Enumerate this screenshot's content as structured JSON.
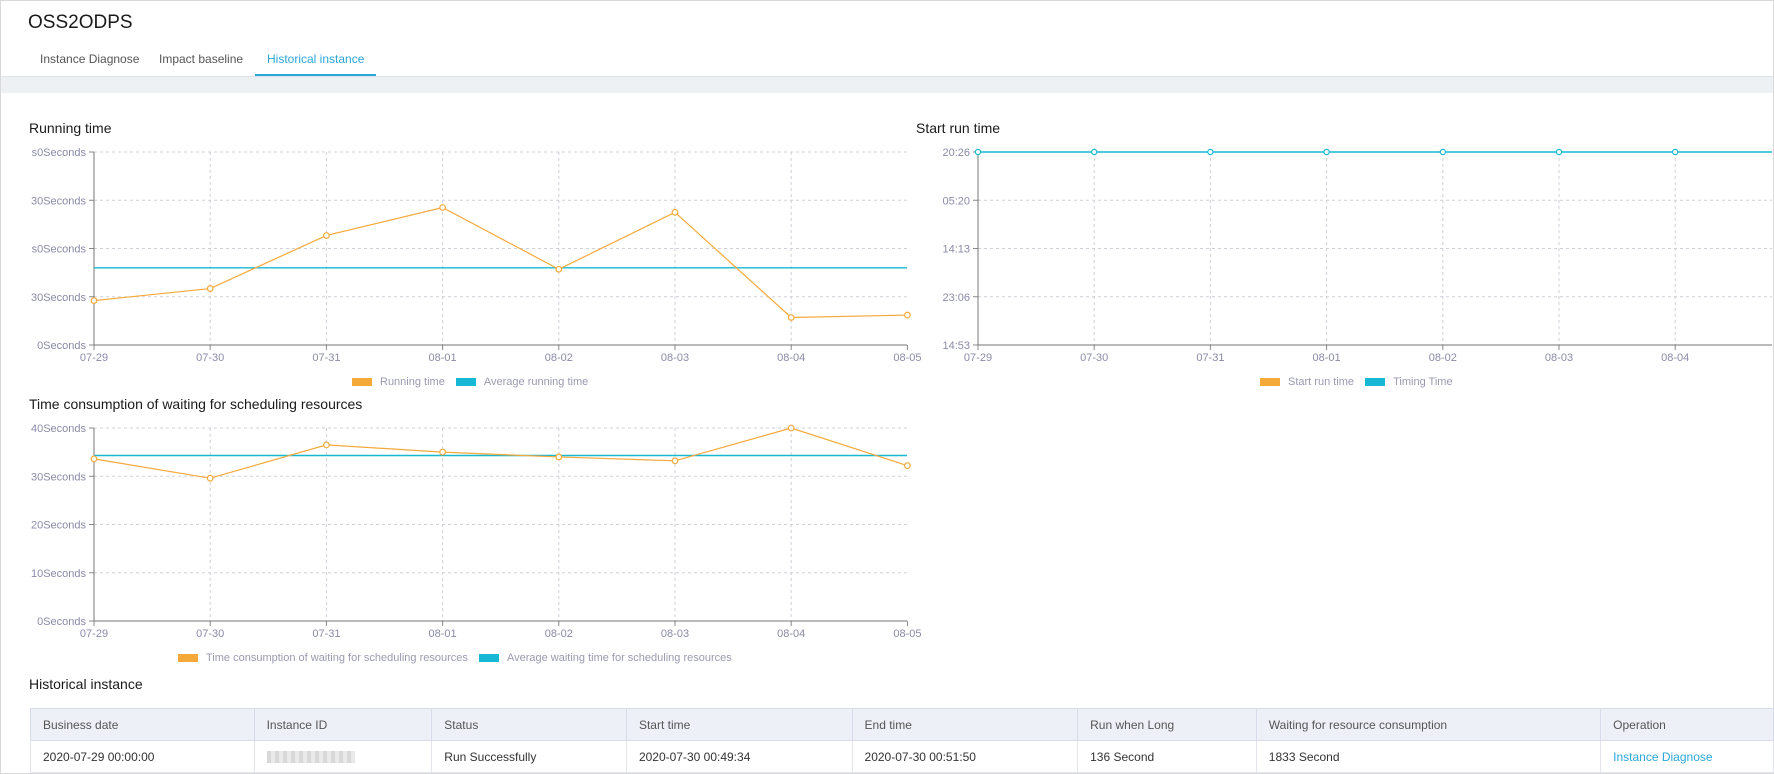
{
  "page": {
    "title": "OSS2ODPS",
    "tabs": [
      "Instance Diagnose",
      "Impact baseline",
      "Historical instance"
    ],
    "active_tab": "Historical instance"
  },
  "colors": {
    "primary_series": "#f5a93b",
    "average_series": "#17b8d4",
    "active_tab": "#2aa7d8",
    "success": "#3aa83a"
  },
  "chart_data": [
    {
      "id": "running_time",
      "type": "line",
      "title": "Running time",
      "categories": [
        "07-29",
        "07-30",
        "07-31",
        "08-01",
        "08-02",
        "08-03",
        "08-04",
        "08-05"
      ],
      "y_tick_labels": [
        "0Seconds",
        "30Seconds",
        "s0Seconds",
        "30Seconds",
        "s0Seconds"
      ],
      "ylim": [
        0,
        4
      ],
      "grid": true,
      "legend_position": "bottom",
      "series": [
        {
          "name": "Running time",
          "color": "#f5a93b",
          "values": [
            0.92,
            1.17,
            2.27,
            2.85,
            1.57,
            2.75,
            0.57,
            0.62
          ]
        },
        {
          "name": "Average running time",
          "color": "#17b8d4",
          "values": [
            1.6,
            1.6,
            1.6,
            1.6,
            1.6,
            1.6,
            1.6,
            1.6
          ]
        }
      ]
    },
    {
      "id": "start_run_time",
      "type": "line",
      "title": "Start run time",
      "categories": [
        "07-29",
        "07-30",
        "07-31",
        "08-01",
        "08-02",
        "08-03",
        "08-04"
      ],
      "y_tick_labels": [
        "14:53",
        "23:06",
        "14:13",
        "05:20",
        "20:26"
      ],
      "ylim": [
        0,
        4
      ],
      "grid": true,
      "legend_position": "bottom",
      "series": [
        {
          "name": "Start run time",
          "color": "#f5a93b",
          "values": [
            4,
            4,
            4,
            4,
            4,
            4,
            4
          ]
        },
        {
          "name": "Timing Time",
          "color": "#17b8d4",
          "values": [
            4,
            4,
            4,
            4,
            4,
            4,
            4
          ]
        }
      ]
    },
    {
      "id": "waiting_time",
      "type": "line",
      "title": "Time consumption of waiting for scheduling resources",
      "categories": [
        "07-29",
        "07-30",
        "07-31",
        "08-01",
        "08-02",
        "08-03",
        "08-04",
        "08-05"
      ],
      "y_tick_labels": [
        "0Seconds",
        "10Seconds",
        "20Seconds",
        "30Seconds",
        "40Seconds"
      ],
      "ylim": [
        0,
        40
      ],
      "grid": true,
      "legend_position": "bottom",
      "series": [
        {
          "name": "Time consumption of waiting for scheduling resources",
          "color": "#f5a93b",
          "values": [
            33.6,
            29.6,
            36.5,
            35.0,
            34.0,
            33.2,
            40.0,
            32.2
          ]
        },
        {
          "name": "Average waiting time for scheduling resources",
          "color": "#17b8d4",
          "values": [
            34.3,
            34.3,
            34.3,
            34.3,
            34.3,
            34.3,
            34.3,
            34.3
          ]
        }
      ]
    }
  ],
  "table": {
    "title": "Historical instance",
    "columns": [
      "Business date",
      "Instance ID",
      "Status",
      "Start time",
      "End time",
      "Run when Long",
      "Waiting for resource consumption",
      "Operation"
    ],
    "rows": [
      {
        "business_date": "2020-07-29 00:00:00",
        "status": "Run Successfully",
        "start_time": "2020-07-30 00:49:34",
        "end_time": "2020-07-30 00:51:50",
        "run_long": "136 Second",
        "waiting": "1833 Second",
        "operation": "Instance Diagnose"
      }
    ]
  }
}
